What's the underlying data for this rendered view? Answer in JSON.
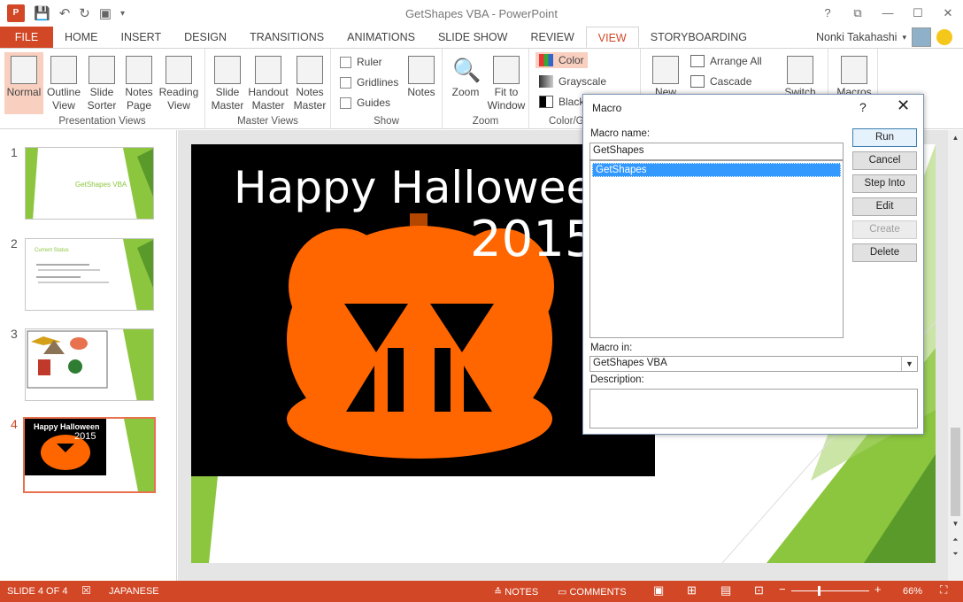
{
  "app": {
    "window_title": "GetShapes VBA - PowerPoint",
    "user_name": "Nonki Takahashi",
    "window_controls": [
      "?",
      "⧉",
      "—",
      "☐",
      "✕"
    ]
  },
  "tabs": [
    "FILE",
    "HOME",
    "INSERT",
    "DESIGN",
    "TRANSITIONS",
    "ANIMATIONS",
    "SLIDE SHOW",
    "REVIEW",
    "VIEW",
    "STORYBOARDING"
  ],
  "active_tab": "VIEW",
  "ribbon": {
    "presentation_views": {
      "label": "Presentation Views",
      "buttons": [
        "Normal",
        "Outline View",
        "Slide Sorter",
        "Notes Page",
        "Reading View"
      ]
    },
    "master_views": {
      "label": "Master Views",
      "buttons": [
        "Slide Master",
        "Handout Master",
        "Notes Master"
      ]
    },
    "show": {
      "label": "Show",
      "checkboxes": [
        "Ruler",
        "Gridlines",
        "Guides"
      ],
      "notes_button": "Notes"
    },
    "zoom": {
      "label": "Zoom",
      "buttons": [
        "Zoom",
        "Fit to Window"
      ]
    },
    "color": {
      "label": "Color/G",
      "options": [
        "Color",
        "Grayscale",
        "Black"
      ]
    },
    "window": {
      "new": "New",
      "arrange_all": "Arrange All",
      "cascade": "Cascade",
      "switch": "Switch"
    },
    "macros": {
      "button": "Macros"
    }
  },
  "thumbnails": [
    {
      "num": "1",
      "title": "GetShapes VBA"
    },
    {
      "num": "2",
      "title": "Current Status"
    },
    {
      "num": "3",
      "title": ""
    },
    {
      "num": "4",
      "title": "Happy Halloween",
      "year": "2015"
    }
  ],
  "selected_slide": "4",
  "slide": {
    "title": "Happy Halloween",
    "year": "2015"
  },
  "status": {
    "slide_info": "SLIDE 4 OF 4",
    "language": "JAPANESE",
    "notes": "NOTES",
    "comments": "COMMENTS",
    "zoom": "66%"
  },
  "dialog": {
    "title": "Macro",
    "help": "?",
    "close": "✕",
    "macro_name_label": "Macro name:",
    "macro_name_value": "GetShapes",
    "list_items": [
      "GetShapes"
    ],
    "macro_in_label": "Macro in:",
    "macro_in_value": "GetShapes VBA",
    "description_label": "Description:",
    "buttons": {
      "run": "Run",
      "cancel": "Cancel",
      "step_into": "Step Into",
      "edit": "Edit",
      "create": "Create",
      "delete": "Delete"
    }
  },
  "colors": {
    "accent": "#d24726",
    "pumpkin": "#ff6600",
    "stem": "#b34700",
    "slide_green": "#8cc63f"
  }
}
